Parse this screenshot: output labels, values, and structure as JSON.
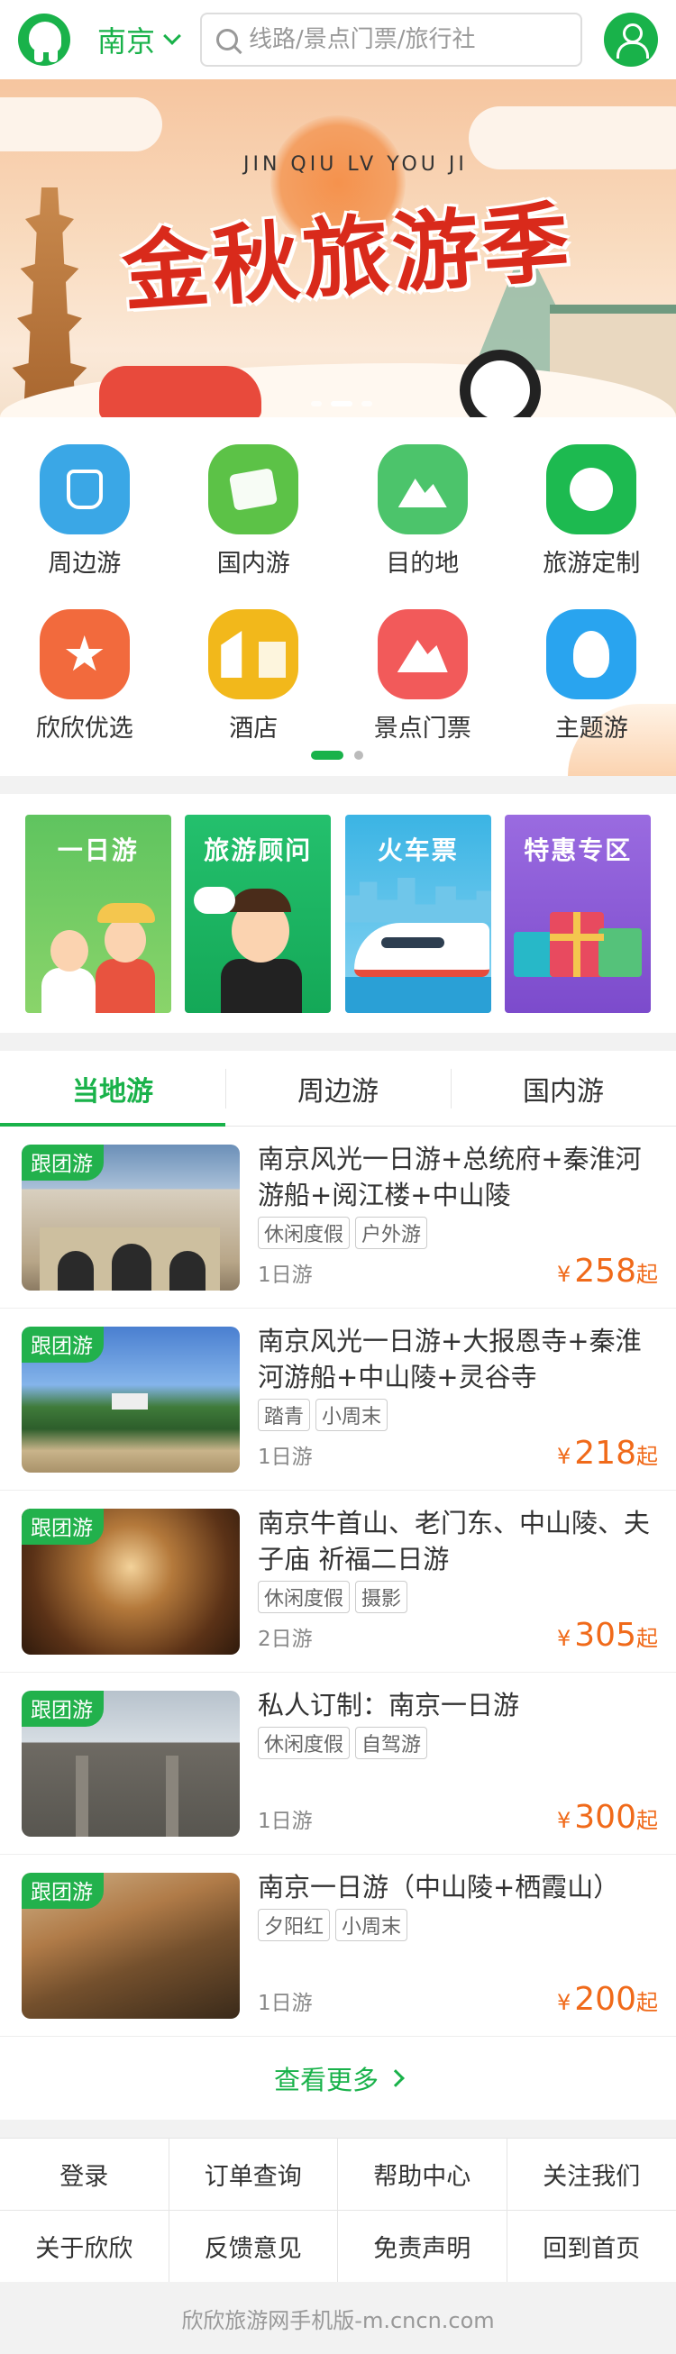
{
  "header": {
    "city": "南京",
    "search_placeholder": "线路/景点门票/旅行社",
    "logo_icon": "elephant-logo-icon",
    "user_icon": "user-icon"
  },
  "banner": {
    "pinyin": "JIN QIU LV YOU JI",
    "title": "金秋旅游季"
  },
  "categories": [
    {
      "label": "周边游",
      "icon": "backpack-icon",
      "color": "#3aa7e6"
    },
    {
      "label": "国内游",
      "icon": "plane-ticket-icon",
      "color": "#5cc247"
    },
    {
      "label": "目的地",
      "icon": "map-pin-icon",
      "color": "#4cc46b"
    },
    {
      "label": "旅游定制",
      "icon": "face-icon",
      "color": "#1dba50"
    },
    {
      "label": "欣欣优选",
      "icon": "star-icon",
      "color": "#f26a3d"
    },
    {
      "label": "酒店",
      "icon": "building-icon",
      "color": "#f2b81b"
    },
    {
      "label": "景点门票",
      "icon": "mountain-icon",
      "color": "#f25a5a"
    },
    {
      "label": "主题游",
      "icon": "balloon-icon",
      "color": "#29a4ef"
    }
  ],
  "promos": [
    {
      "label": "一日游"
    },
    {
      "label": "旅游顾问"
    },
    {
      "label": "火车票"
    },
    {
      "label": "特惠专区"
    }
  ],
  "tabs": [
    {
      "label": "当地游",
      "active": true
    },
    {
      "label": "周边游",
      "active": false
    },
    {
      "label": "国内游",
      "active": false
    }
  ],
  "products": [
    {
      "badge": "跟团游",
      "title": "南京风光一日游+总统府+秦淮河游船+阅江楼+中山陵",
      "tags": [
        "休闲度假",
        "户外游"
      ],
      "days": "1日游",
      "currency": "¥",
      "price": "258",
      "suffix": "起"
    },
    {
      "badge": "跟团游",
      "title": "南京风光一日游+大报恩寺+秦淮河游船+中山陵+灵谷寺",
      "tags": [
        "踏青",
        "小周末"
      ],
      "days": "1日游",
      "currency": "¥",
      "price": "218",
      "suffix": "起"
    },
    {
      "badge": "跟团游",
      "title": "南京牛首山、老门东、中山陵、夫子庙 祈福二日游",
      "tags": [
        "休闲度假",
        "摄影"
      ],
      "days": "2日游",
      "currency": "¥",
      "price": "305",
      "suffix": "起"
    },
    {
      "badge": "跟团游",
      "title": "私人订制：南京一日游",
      "tags": [
        "休闲度假",
        "自驾游"
      ],
      "days": "1日游",
      "currency": "¥",
      "price": "300",
      "suffix": "起"
    },
    {
      "badge": "跟团游",
      "title": "南京一日游（中山陵+栖霞山）",
      "tags": [
        "夕阳红",
        "小周末"
      ],
      "days": "1日游",
      "currency": "¥",
      "price": "200",
      "suffix": "起"
    }
  ],
  "more_label": "查看更多",
  "footer_links": [
    "登录",
    "订单查询",
    "帮助中心",
    "关注我们",
    "关于欣欣",
    "反馈意见",
    "免责声明",
    "回到首页"
  ],
  "copyright": "欣欣旅游网手机版-m.cncn.com",
  "colors": {
    "brand": "#19b24a",
    "price": "#f06a1a"
  }
}
